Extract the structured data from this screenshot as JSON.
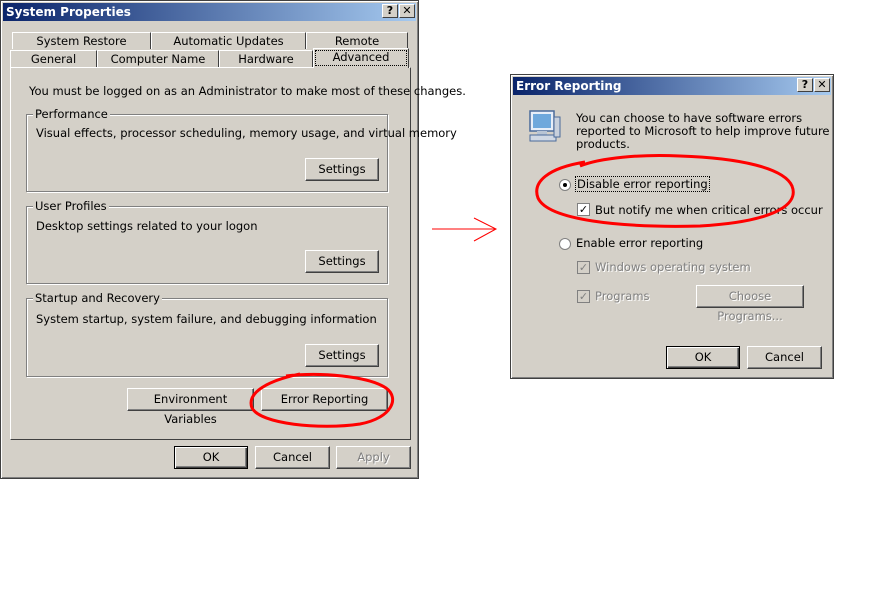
{
  "system_properties": {
    "title": "System Properties",
    "help_btn": "?",
    "close_btn": "✕",
    "tabs_row1": [
      "System Restore",
      "Automatic Updates",
      "Remote"
    ],
    "tabs_row2": [
      "General",
      "Computer Name",
      "Hardware",
      "Advanced"
    ],
    "admin_note": "You must be logged on as an Administrator to make most of these changes.",
    "performance": {
      "label": "Performance",
      "text": "Visual effects, processor scheduling, memory usage, and virtual memory",
      "button": "Settings"
    },
    "user_profiles": {
      "label": "User Profiles",
      "text": "Desktop settings related to your logon",
      "button": "Settings"
    },
    "startup_recovery": {
      "label": "Startup and Recovery",
      "text": "System startup, system failure, and debugging information",
      "button": "Settings"
    },
    "env_vars": "Environment Variables",
    "error_reporting": "Error Reporting",
    "ok": "OK",
    "cancel": "Cancel",
    "apply": "Apply"
  },
  "error_reporting_dialog": {
    "title": "Error Reporting",
    "help_btn": "?",
    "close_btn": "✕",
    "intro": [
      "You can choose to have software errors",
      "reported to Microsoft to help improve future",
      "products."
    ],
    "disable_label": "Disable error reporting",
    "disable_selected": true,
    "notify_label": "But notify me when critical errors occur",
    "notify_checked": true,
    "enable_label": "Enable error reporting",
    "windows_os_label": "Windows operating system",
    "programs_label": "Programs",
    "choose_programs": "Choose Programs...",
    "ok": "OK",
    "cancel": "Cancel"
  },
  "colors": {
    "annotation": "#ff0000",
    "title_start": "#0a246a",
    "title_end": "#a6caf0",
    "face": "#d4d0c8"
  }
}
